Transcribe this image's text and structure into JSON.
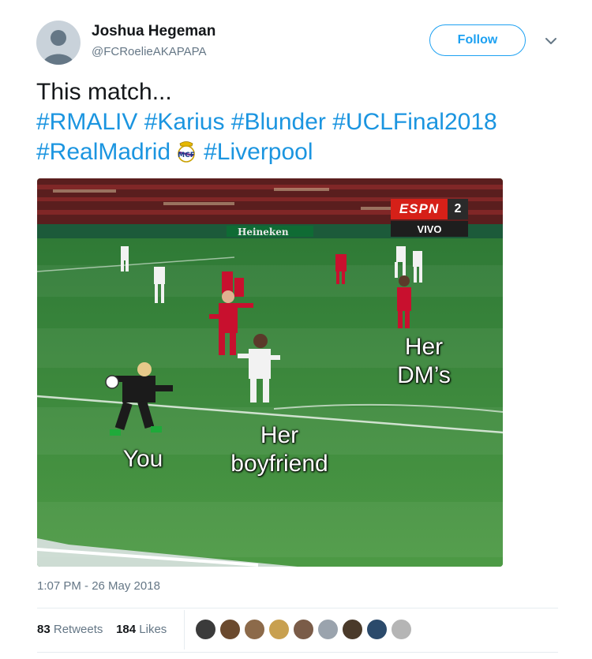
{
  "author": {
    "name": "Joshua Hegeman",
    "handle": "@FCRoelieAKAPAPA",
    "avatar_icon": "default-profile-icon"
  },
  "follow_label": "Follow",
  "tweet": {
    "line1": "This match...",
    "hashtags_line2": [
      "#RMALIV",
      "#Karius",
      "#Blunder",
      "#UCLFinal2018"
    ],
    "hashtags_line3a": "#RealMadrid",
    "emoji_icon": "real-madrid-crest-emoji",
    "hashtags_line3b": "#Liverpool"
  },
  "media": {
    "broadcaster_logo": "ESPN",
    "channel_number": "2",
    "live_label": "VIVO",
    "sponsor_board": "Heineken",
    "meme_labels": {
      "dms": [
        "Her",
        "DM’s"
      ],
      "boyfriend": [
        "Her",
        "boyfriend"
      ],
      "you": "You"
    }
  },
  "timestamp": "1:07 PM - 26 May 2018",
  "stats": {
    "retweets_count": "83",
    "retweets_label": "Retweets",
    "likes_count": "184",
    "likes_label": "Likes"
  },
  "liker_avatars": [
    "#3b3b3b",
    "#6b4a2e",
    "#8c6a4a",
    "#c8a050",
    "#7a5c48",
    "#9aa3ad",
    "#4a3a2a",
    "#2b4a6b",
    "#b5b5b5"
  ],
  "colors": {
    "accent": "#1da1f2",
    "hashtag": "#1b95e0",
    "muted": "#657786"
  }
}
